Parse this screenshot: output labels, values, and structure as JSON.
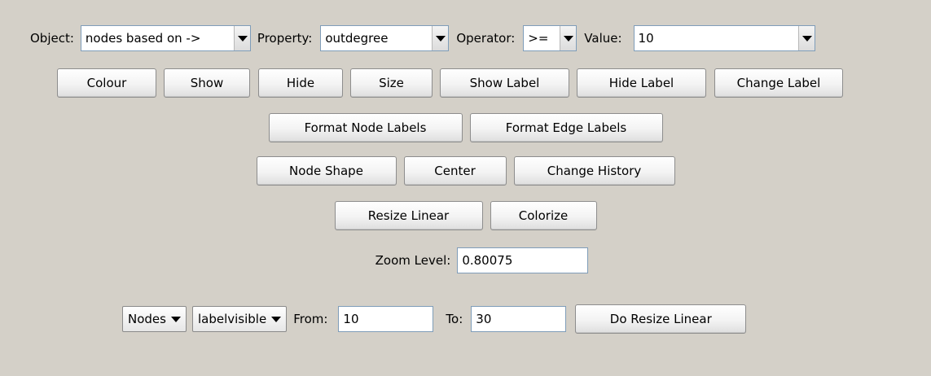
{
  "filter": {
    "object_label": "Object:",
    "object_value": "nodes based on ->",
    "property_label": "Property:",
    "property_value": "outdegree",
    "operator_label": "Operator:",
    "operator_value": ">=",
    "value_label": "Value:",
    "value_value": "10"
  },
  "actions_row1": {
    "colour": "Colour",
    "show": "Show",
    "hide": "Hide",
    "size": "Size",
    "show_label": "Show Label",
    "hide_label": "Hide Label",
    "change_label": "Change Label"
  },
  "actions_row2": {
    "format_node_labels": "Format Node Labels",
    "format_edge_labels": "Format Edge Labels"
  },
  "actions_row3": {
    "node_shape": "Node Shape",
    "center": "Center",
    "change_history": "Change History"
  },
  "actions_row4": {
    "resize_linear": "Resize Linear",
    "colorize": "Colorize"
  },
  "zoom": {
    "label": "Zoom Level:",
    "value": "0.80075"
  },
  "resize": {
    "target_value": "Nodes",
    "attribute_value": "labelvisible",
    "from_label": "From:",
    "from_value": "10",
    "to_label": "To:",
    "to_value": "30",
    "do_button": "Do Resize Linear"
  }
}
